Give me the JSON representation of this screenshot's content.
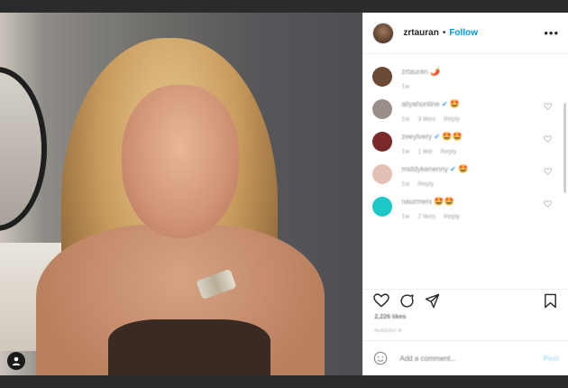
{
  "header": {
    "username": "zrtauran",
    "separator": "•",
    "follow_label": "Follow",
    "more_label": "•••"
  },
  "comments": [
    {
      "name": "zrtauran",
      "emoji": "🌶️",
      "verified": false,
      "meta": [
        "1w"
      ],
      "avatar": "#6b4a35"
    },
    {
      "name": "aliyahonline",
      "emoji": "🤩",
      "verified": true,
      "meta": [
        "1w",
        "3 likes",
        "Reply"
      ],
      "avatar": "#9a8f88"
    },
    {
      "name": "zeeylvery",
      "emoji": "🤩🤩",
      "verified": true,
      "meta": [
        "1w",
        "1 like",
        "Reply"
      ],
      "avatar": "#7a2a2a"
    },
    {
      "name": "middykenenny",
      "emoji": "🤩",
      "verified": true,
      "meta": [
        "1w",
        "Reply"
      ],
      "avatar": "#e4c0b4"
    },
    {
      "name": "naurmers",
      "emoji": "🤩🤩",
      "verified": false,
      "meta": [
        "1w",
        "2 likes",
        "Reply"
      ],
      "avatar": "#1ec8c8"
    }
  ],
  "likes": "2,226 likes",
  "date": "AUGUST 8",
  "add_comment": {
    "placeholder": "Add a comment...",
    "post_label": "Post"
  },
  "colors": {
    "follow": "#0095f6",
    "verified": "#3897f0"
  },
  "icons": [
    "heart-icon",
    "comment-icon",
    "share-icon",
    "bookmark-icon",
    "emoji-icon",
    "more-icon",
    "user-tag-icon"
  ]
}
